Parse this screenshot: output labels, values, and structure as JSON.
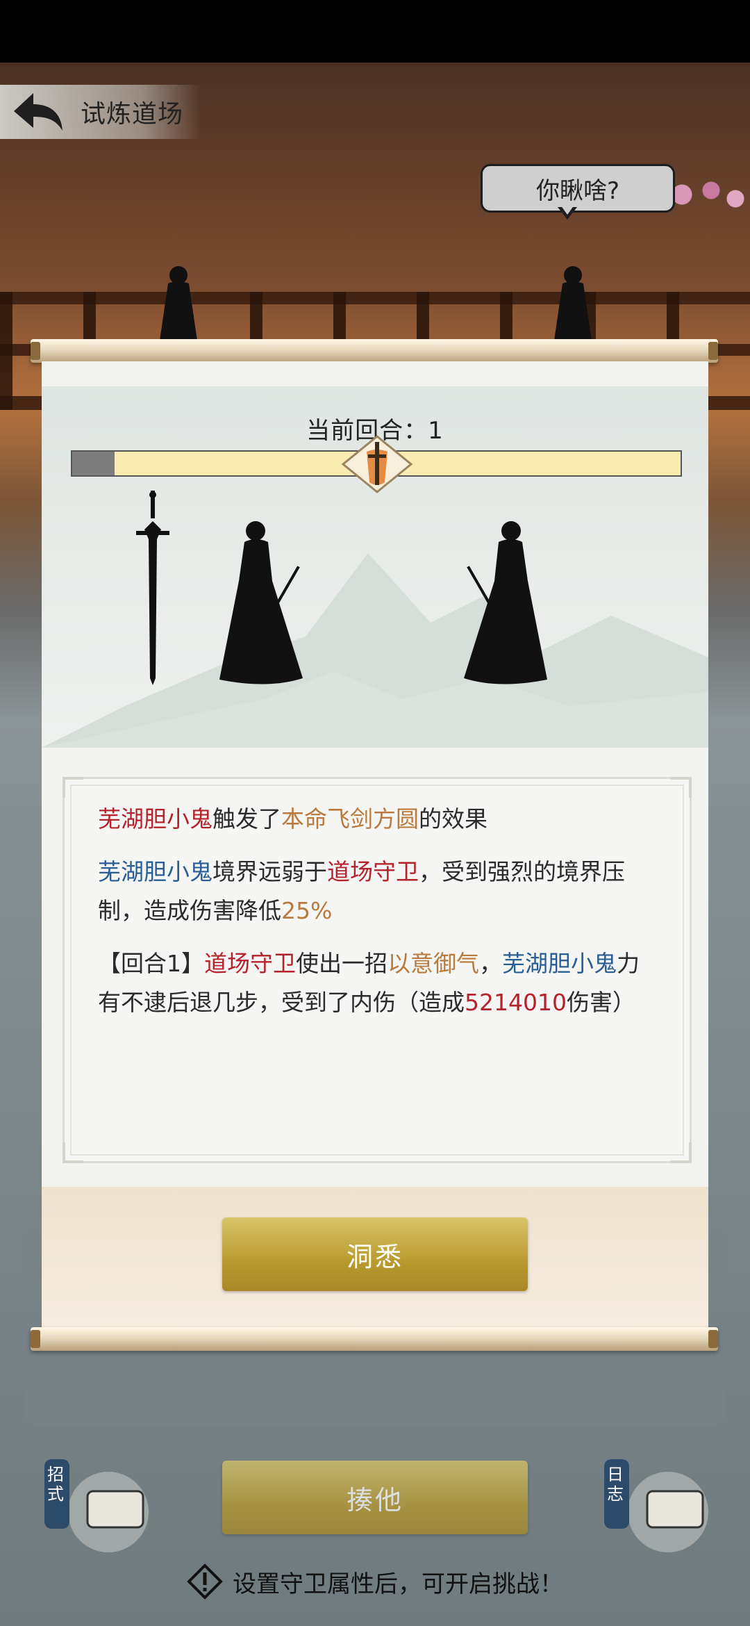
{
  "header": {
    "title": "试炼道场",
    "speech_bubble": "你瞅啥?"
  },
  "battle": {
    "round_label": "当前回合：1",
    "progress_fraction": 0.07
  },
  "log": [
    [
      {
        "text": "芜湖胆小鬼",
        "color": "red"
      },
      {
        "text": "触发了",
        "color": ""
      },
      {
        "text": "本命飞剑方圆",
        "color": "gold"
      },
      {
        "text": "的效果",
        "color": ""
      }
    ],
    [
      {
        "text": "芜湖胆小鬼",
        "color": "blue"
      },
      {
        "text": "境界远弱于",
        "color": ""
      },
      {
        "text": "道场守卫",
        "color": "red"
      },
      {
        "text": "，受到强烈的境界压制，造成伤害降低",
        "color": ""
      },
      {
        "text": "25%",
        "color": "gold"
      }
    ],
    [
      {
        "text": "【回合1】",
        "color": ""
      },
      {
        "text": "道场守卫",
        "color": "red"
      },
      {
        "text": "使出一招",
        "color": ""
      },
      {
        "text": "以意御气",
        "color": "gold"
      },
      {
        "text": "，",
        "color": ""
      },
      {
        "text": "芜湖胆小鬼",
        "color": "blue"
      },
      {
        "text": "力有不逮后退几步，受到了内伤（造成",
        "color": ""
      },
      {
        "text": "5214010",
        "color": "red"
      },
      {
        "text": "伤害）",
        "color": ""
      }
    ]
  ],
  "modal": {
    "confirm_label": "洞悉"
  },
  "footer": {
    "action_label": "揍他",
    "left_tab": "招式",
    "right_tab": "日志",
    "warning": "设置守卫属性后，可开启挑战！"
  },
  "colors": {
    "red": "#b4232b",
    "gold": "#b87a3e",
    "blue": "#285e95",
    "button_gold": "#b99a2e"
  },
  "icons": [
    "back-arrow-icon",
    "sword-icon",
    "warning-icon",
    "scroll-icon"
  ]
}
